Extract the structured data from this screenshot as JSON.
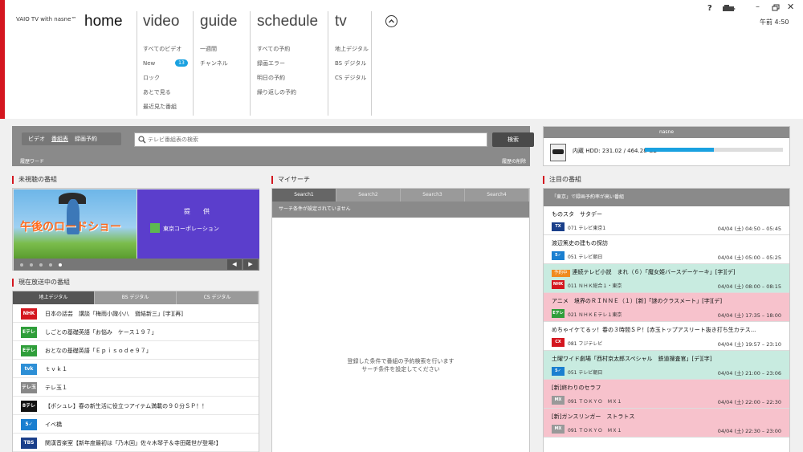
{
  "app": {
    "title": "VAIO TV with nasne™"
  },
  "nav": {
    "home": {
      "label": "home",
      "items": []
    },
    "video": {
      "label": "video",
      "items": [
        "すべてのビデオ",
        "New",
        "ロック",
        "あとで見る",
        "最近見た番組"
      ],
      "new_count": "13"
    },
    "guide": {
      "label": "guide",
      "items": [
        "一週間",
        "チャンネル"
      ]
    },
    "schedule": {
      "label": "schedule",
      "items": [
        "すべての予約",
        "録画エラー",
        "明日の予約",
        "繰り返しの予約"
      ]
    },
    "tv": {
      "label": "tv",
      "items": [
        "地上デジタル",
        "BS デジタル",
        "CS デジタル"
      ]
    }
  },
  "window": {
    "help": "?",
    "minimize": "–",
    "close": "✕",
    "clock": "午前 4:50"
  },
  "search": {
    "tabs": [
      "ビデオ",
      "番組表",
      "録画予約"
    ],
    "placeholder": "テレビ番組表の検索",
    "button": "検索",
    "history_label": "履歴ワード",
    "history_delete": "履歴の削除"
  },
  "nasne": {
    "header": "nasne",
    "storage_text": "内蔵 HDD:  231.02 / 464.28 GB",
    "used_fraction": 0.4976
  },
  "unwatched": {
    "title": "未視聴の番組",
    "banner_title": "午後のロードショー",
    "sponsor_label": "提　供",
    "sponsor_name": "東京コーポレーション",
    "prev": "◀",
    "next": "▶"
  },
  "onair": {
    "title": "現在放送中の番組",
    "tabs": [
      "地上デジタル",
      "BS デジタル",
      "CS デジタル"
    ],
    "rows": [
      {
        "logo": "NHK",
        "color": "#d4161f",
        "program": "日本の話芸　講談「梅雨小諏小八　聳結新三」[字][再]"
      },
      {
        "logo": "Eテレ",
        "color": "#2f9e3a",
        "program": "しごとの基礎英語「お悩み　ケース１９７」"
      },
      {
        "logo": "Eテレ",
        "color": "#2f9e3a",
        "program": "おとなの基礎英語「Ｅｐｉｓｏｄｅ９７」"
      },
      {
        "logo": "tvk",
        "color": "#2d8fd6",
        "program": "ｔｖｋ１"
      },
      {
        "logo": "テレ玉",
        "color": "#888888",
        "program": "テレ玉１"
      },
      {
        "logo": "8テレ",
        "color": "#111111",
        "program": "【ポシュレ】春の新生活に役立つアイテム満載の９０分ＳＰ！！"
      },
      {
        "logo": "5✓",
        "color": "#1a7fd0",
        "program": "イベ橋"
      },
      {
        "logo": "TBS",
        "color": "#1a3f8a",
        "program": "関漢音楽室【新年度最初は「乃木回」佐々木琴子＆寺田薙世が登場!】"
      }
    ]
  },
  "mysearch": {
    "title": "マイサーチ",
    "tabs": [
      "Search1",
      "Search2",
      "Search3",
      "Search4"
    ],
    "condition": "サーチ条件が設定されていません",
    "message_line1": "登録した条件で番組の予約検索を行います",
    "message_line2": "サーチ条件を設定してください"
  },
  "featured": {
    "title": "注目の番組",
    "header": "「東京」で録画予約率が高い番組",
    "rows": [
      {
        "style": "white",
        "tag": "",
        "title": "ものスタ　サタデー",
        "logo": "TX",
        "logo_color": "#1a3f8a",
        "channel": "071  テレビ東京1",
        "time": "04/04 (土) 04:50 – 05:45"
      },
      {
        "style": "white",
        "tag": "",
        "title": "渡辺篤史の建もの探訪",
        "logo": "5✓",
        "logo_color": "#1a7fd0",
        "channel": "051  テレビ朝日",
        "time": "04/04 (土) 05:00 – 05:25"
      },
      {
        "style": "green",
        "tag": "予約中",
        "title": "連続テレビ小説　まれ（６）「魔女姫バースデーケーキ」[字][デ]",
        "logo": "NHK",
        "logo_color": "#d4161f",
        "channel": "011  ＮＨＫ総合１・東京",
        "time": "04/04 (土) 08:00 – 08:15"
      },
      {
        "style": "pink",
        "tag": "",
        "title": "アニメ　境界のＲＩＮＮＥ（１）[新]「謎のクラスメート」[字][デ]",
        "logo": "Eテレ",
        "logo_color": "#2f9e3a",
        "channel": "021  ＮＨＫＥテレ１東京",
        "time": "04/04 (土) 17:35 – 18:00"
      },
      {
        "style": "white",
        "tag": "",
        "title": "めちゃイケてるッ！春の３時間ＳＰ！[赤玉トップアスリート抜き打ち生カテス...",
        "logo": "CX",
        "logo_color": "#d4161f",
        "channel": "081  フジテレビ",
        "time": "04/04 (土) 19:57 – 23:10"
      },
      {
        "style": "green",
        "tag": "",
        "title": "土曜ワイド劇場「西村京太郎スペシャル　鉄道捜査官」[デ][字]",
        "logo": "5✓",
        "logo_color": "#1a7fd0",
        "channel": "051  テレビ朝日",
        "time": "04/04 (土) 21:00 – 23:06"
      },
      {
        "style": "pink",
        "tag": "",
        "title": "[新]終わりのセラフ",
        "logo": "MX",
        "logo_color": "#999999",
        "channel": "091  ＴＯＫＹＯ　ＭＸ１",
        "time": "04/04 (土) 22:00 – 22:30"
      },
      {
        "style": "pink",
        "tag": "",
        "title": "[新]ガンスリンガー　ストラトス",
        "logo": "MX",
        "logo_color": "#999999",
        "channel": "091  ＴＯＫＹＯ　ＭＸ１",
        "time": "04/04 (土) 22:30 – 23:00"
      }
    ]
  }
}
